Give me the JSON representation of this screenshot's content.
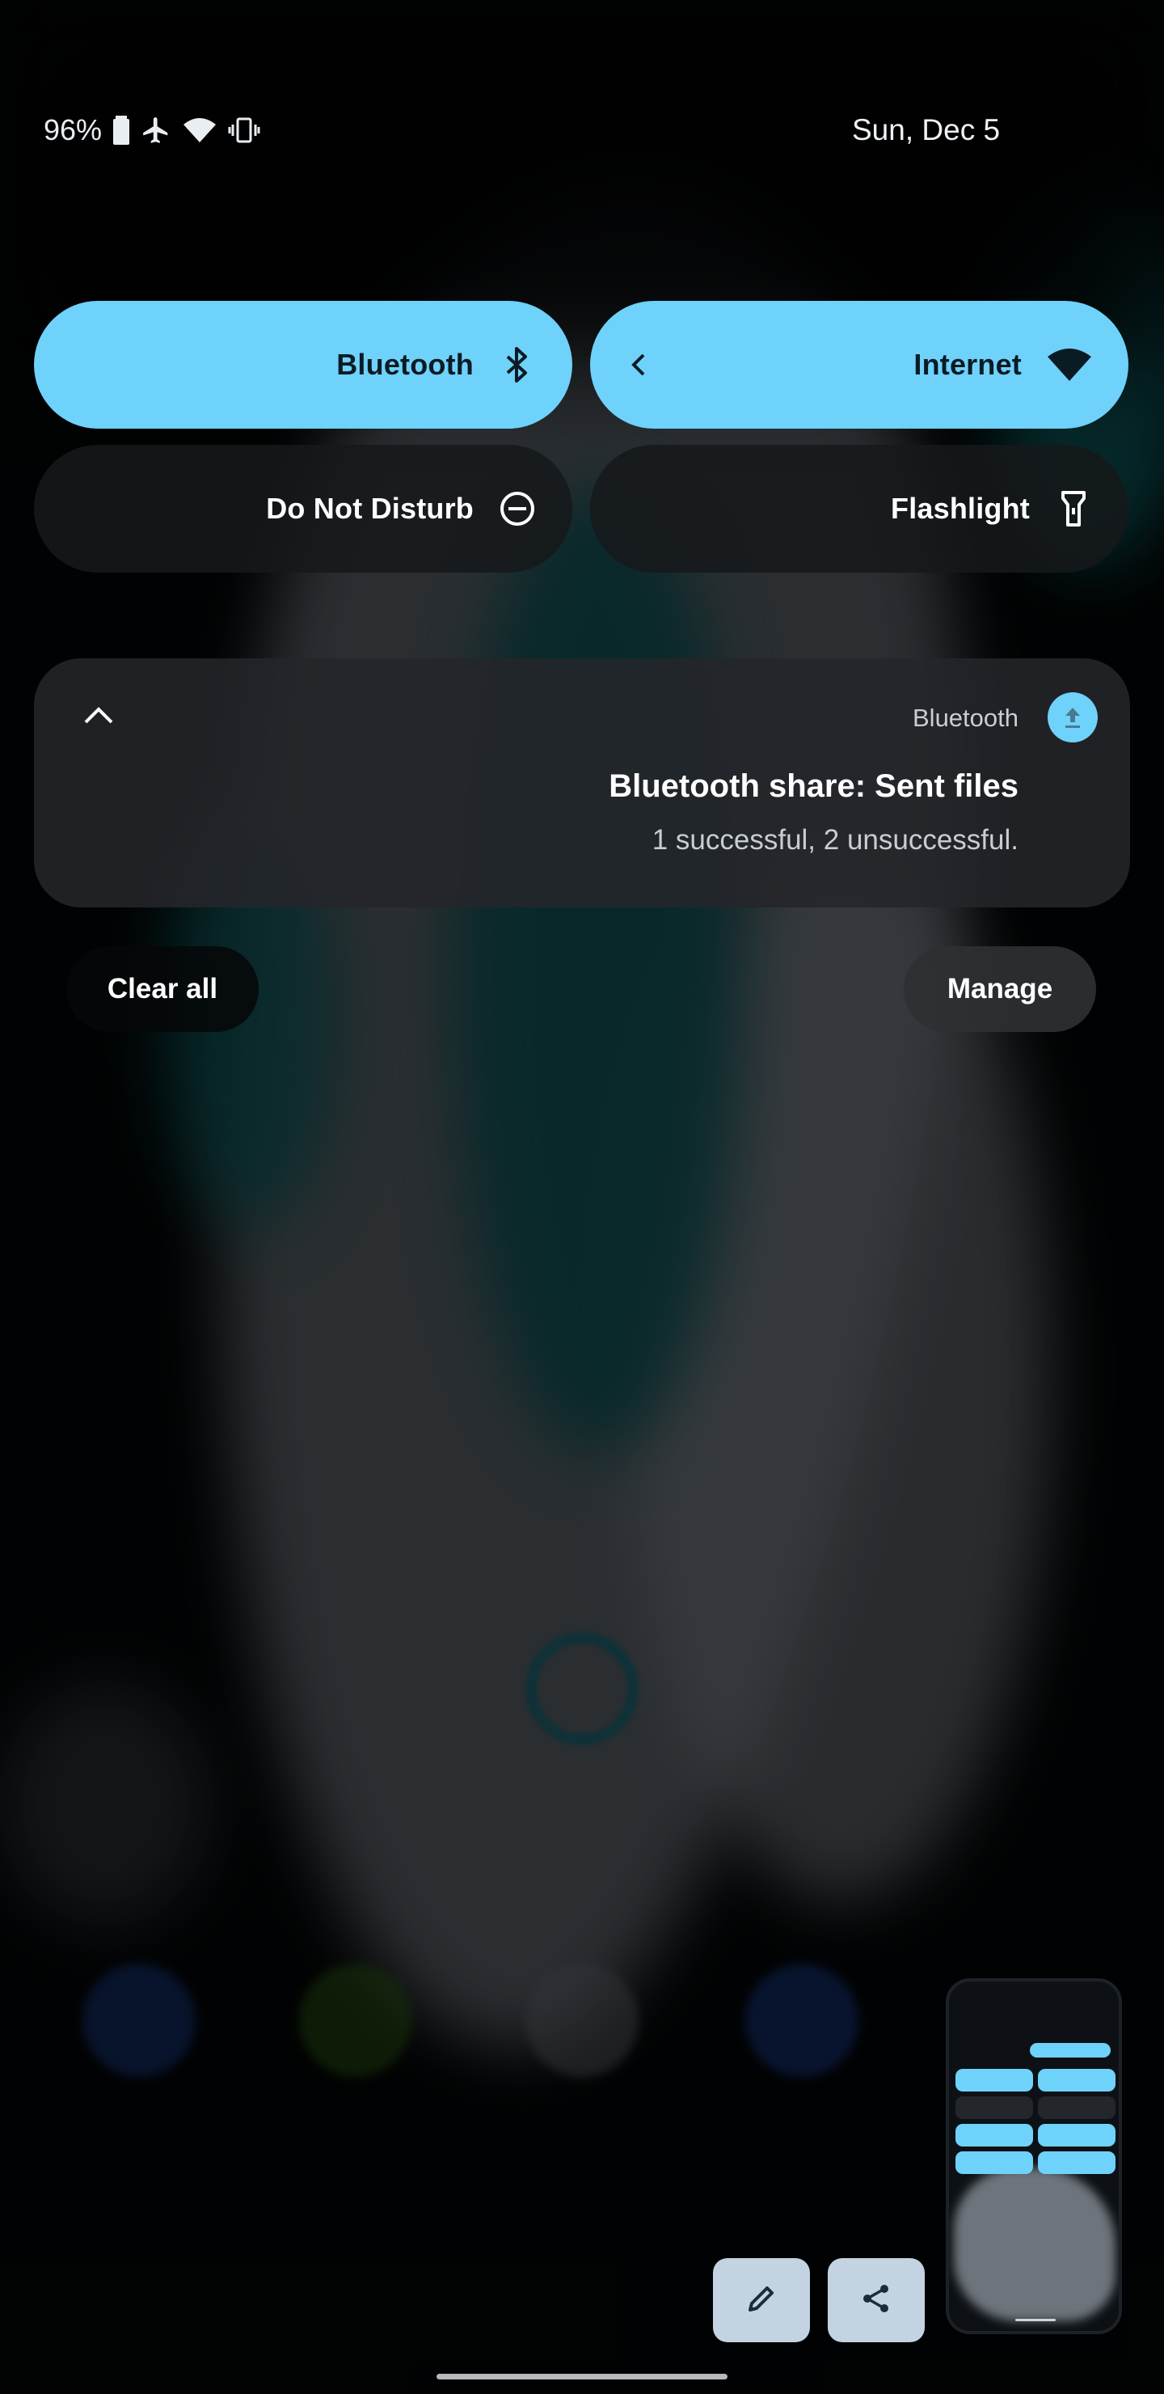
{
  "status_bar": {
    "battery": "96%",
    "date": "Sun, Dec 5",
    "icons": [
      "battery-icon",
      "airplane-mode-icon",
      "wifi-icon",
      "vibrate-icon"
    ]
  },
  "quick_settings": {
    "tiles": [
      {
        "label": "Bluetooth",
        "icon": "bluetooth-icon",
        "state": "on"
      },
      {
        "label": "Internet",
        "icon": "wifi-icon",
        "state": "on"
      },
      {
        "label": "Do Not Disturb",
        "icon": "do-not-disturb-icon",
        "state": "off"
      },
      {
        "label": "Flashlight",
        "icon": "flashlight-icon",
        "state": "off"
      }
    ]
  },
  "notification": {
    "app_name": "Bluetooth",
    "title": "Bluetooth share: Sent files",
    "body": "1 successful, 2 unsuccessful.",
    "icon": "upload-icon"
  },
  "actions": {
    "clear_all": "Clear all",
    "manage": "Manage"
  },
  "screenshot_overlay": {
    "edit_icon": "pencil-icon",
    "share_icon": "share-icon"
  },
  "colors": {
    "accent": "#6fd2fb",
    "tile_off": "#16181b",
    "notification_bg": "#24262a"
  }
}
